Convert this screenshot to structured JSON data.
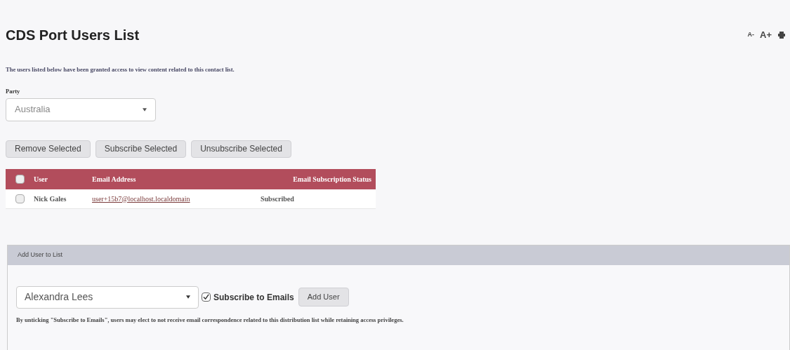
{
  "title": "CDS Port Users List",
  "font_tools": [
    "A-",
    "A+"
  ],
  "intro": "The users listed below have been granted access to view content related to this contact list.",
  "party": {
    "label": "Party",
    "value": "Australia"
  },
  "actions": [
    "Remove Selected",
    "Subscribe Selected",
    "Unsubscribe Selected"
  ],
  "table": {
    "select_all": {
      "checked": false
    },
    "columns": [
      "User",
      "Email Address",
      "Email Subscription Status"
    ],
    "rows": [
      {
        "checked": false,
        "user": "Nick Gales",
        "email": "user+15b7@localhost.localdomain",
        "status": "Subscribed"
      }
    ]
  },
  "add_panel": {
    "title": "Add User to List",
    "user": "Alexandra Lees",
    "subscribe": {
      "label": "Subscribe to Emails",
      "checked": true
    },
    "button": "Add User",
    "note": "By unticking \"Subscribe to Emails\", users may elect to not receive email correspondence related to this distribution list while retaining access privileges."
  }
}
